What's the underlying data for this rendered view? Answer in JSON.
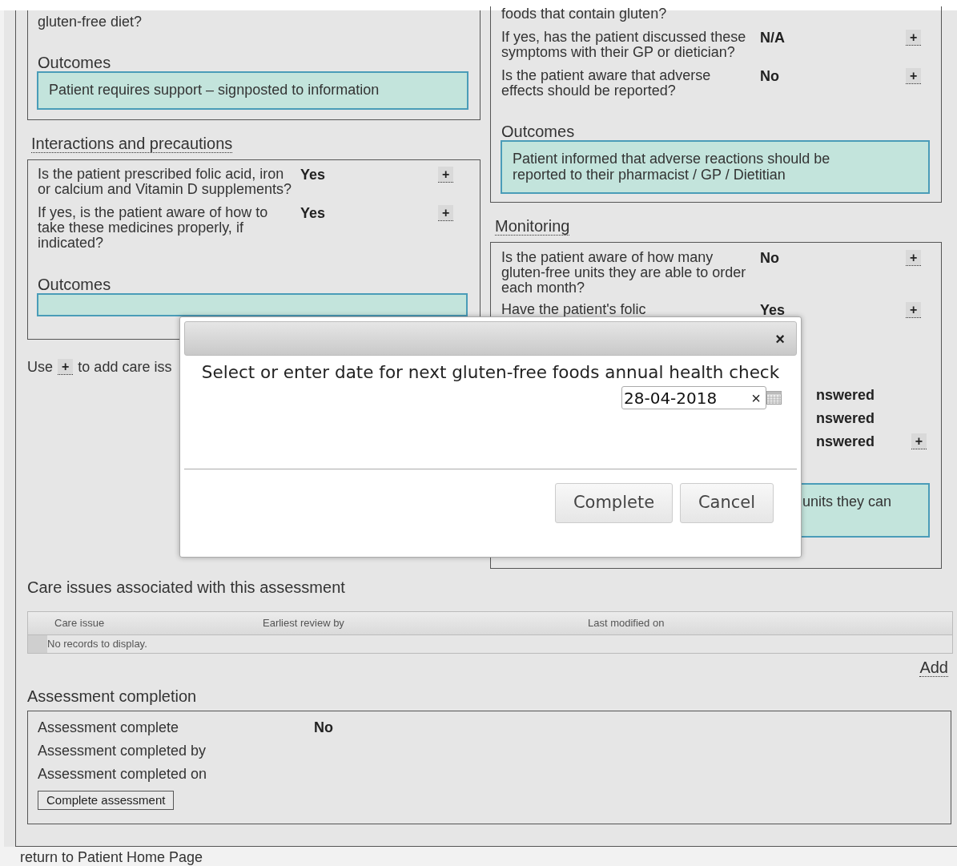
{
  "left_column": {
    "top_card": {
      "question_tail": "gluten-free diet?",
      "outcomes_label": "Outcomes",
      "outcome": "Patient requires support – signposted to information"
    },
    "interactions": {
      "heading": "Interactions and precautions",
      "questions": [
        {
          "text": "Is the patient prescribed folic acid, iron or calcium and Vitamin D supplements?",
          "answer": "Yes",
          "add": "+"
        },
        {
          "text": "If yes, is the patient aware of how to take these medicines properly, if indicated?",
          "answer": "Yes",
          "add": "+"
        }
      ],
      "outcomes_label": "Outcomes"
    },
    "hint": {
      "before": "Use",
      "button": "+",
      "after": "to add care iss"
    }
  },
  "right_column": {
    "top_card": {
      "question_tail": "foods that contain gluten?",
      "questions": [
        {
          "text": "If yes, has the patient discussed these symptoms with their GP or dietician?",
          "answer": "N/A",
          "add": "+"
        },
        {
          "text": "Is the patient aware that adverse effects should be reported?",
          "answer": "No",
          "add": "+"
        }
      ],
      "outcomes_label": "Outcomes",
      "outcome": "Patient informed that adverse reactions should be reported to their pharmacist / GP / Dietitian"
    },
    "monitoring": {
      "heading": "Monitoring",
      "questions": [
        {
          "kind": "full",
          "text": "Is the patient aware of how many gluten-free units they are able to order each month?",
          "answer": "No",
          "add": "+"
        },
        {
          "kind": "covered",
          "text": "Have the patient's folic",
          "answer": "Yes",
          "add": "+"
        },
        {
          "kind": "fragment",
          "answer": "nswered"
        },
        {
          "kind": "fragment",
          "answer": "nswered"
        },
        {
          "kind": "fragment",
          "answer": "nswered",
          "add": "+"
        }
      ],
      "outcome_tail": "units they can"
    }
  },
  "care_issues": {
    "heading": "Care issues associated with this assessment",
    "columns": [
      "Care issue",
      "Earliest review by",
      "Last modified on"
    ],
    "empty": "No records to display.",
    "add": "Add"
  },
  "completion": {
    "heading": "Assessment completion",
    "rows": [
      {
        "label": "Assessment complete",
        "value": "No"
      },
      {
        "label": "Assessment completed by"
      },
      {
        "label": "Assessment completed on"
      }
    ],
    "button": "Complete assessment"
  },
  "return_link": "return to Patient Home Page",
  "dialog": {
    "close": "×",
    "prompt": "Select or enter date for next gluten-free foods annual health check",
    "date_field": {
      "value": "28-04-2018",
      "clear": "×"
    },
    "buttons": [
      "Complete",
      "Cancel"
    ]
  }
}
